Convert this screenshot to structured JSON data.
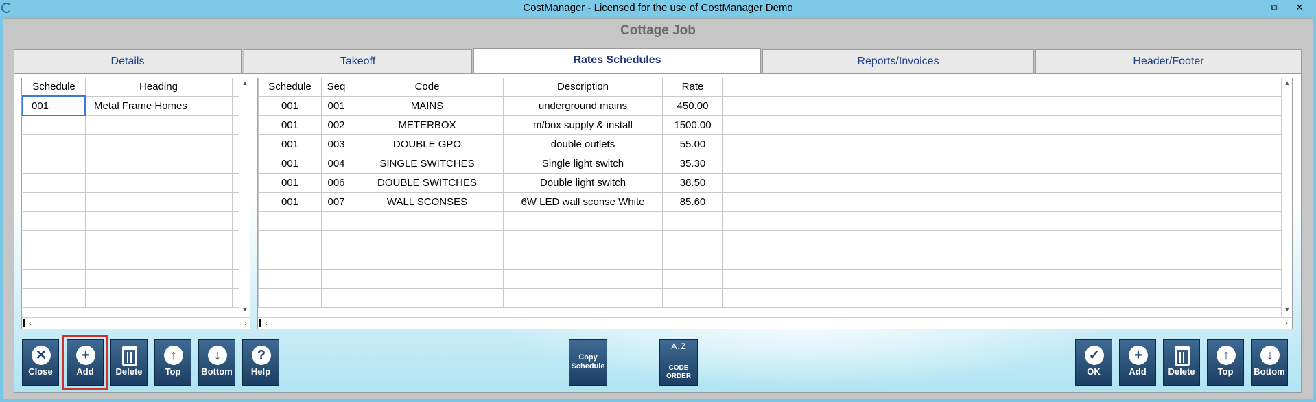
{
  "window": {
    "title": "CostManager - Licensed for the use of CostManager Demo",
    "minimize": "–",
    "restore": "⧉",
    "close": "✕"
  },
  "job_title": "Cottage Job",
  "tabs": [
    {
      "label": "Details"
    },
    {
      "label": "Takeoff"
    },
    {
      "label": "Rates Schedules"
    },
    {
      "label": "Reports/Invoices"
    },
    {
      "label": "Header/Footer"
    }
  ],
  "schedules_grid": {
    "headers": [
      "Schedule",
      "Heading"
    ],
    "rows": [
      {
        "schedule": "001",
        "heading": "Metal Frame Homes"
      }
    ]
  },
  "rates_grid": {
    "headers": [
      "Schedule",
      "Seq",
      "Code",
      "Description",
      "Rate"
    ],
    "rows": [
      {
        "schedule": "001",
        "seq": "001",
        "code": "MAINS",
        "description": "underground mains",
        "rate": "450.00"
      },
      {
        "schedule": "001",
        "seq": "002",
        "code": "METERBOX",
        "description": "m/box supply & install",
        "rate": "1500.00"
      },
      {
        "schedule": "001",
        "seq": "003",
        "code": "DOUBLE GPO",
        "description": "double outlets",
        "rate": "55.00"
      },
      {
        "schedule": "001",
        "seq": "004",
        "code": "SINGLE SWITCHES",
        "description": "Single light switch",
        "rate": "35.30"
      },
      {
        "schedule": "001",
        "seq": "006",
        "code": "DOUBLE SWITCHES",
        "description": "Double light switch",
        "rate": "38.50"
      },
      {
        "schedule": "001",
        "seq": "007",
        "code": "WALL SCONSES",
        "description": "6W LED wall sconse White",
        "rate": "85.60"
      }
    ]
  },
  "left_buttons": [
    {
      "label": "Close",
      "icon": "close-icon",
      "glyph": "✕"
    },
    {
      "label": "Add",
      "icon": "plus-icon",
      "glyph": "+"
    },
    {
      "label": "Delete",
      "icon": "trash-icon",
      "glyph": ""
    },
    {
      "label": "Top",
      "icon": "arrow-up-icon",
      "glyph": "↑"
    },
    {
      "label": "Bottom",
      "icon": "arrow-down-icon",
      "glyph": "↓"
    },
    {
      "label": "Help",
      "icon": "help-icon",
      "glyph": "?"
    }
  ],
  "center_buttons": {
    "copy_schedule": {
      "line1": "Copy",
      "line2": "Schedule"
    },
    "code_order": {
      "az": "A↓Z",
      "line1": "CODE",
      "line2": "ORDER"
    }
  },
  "right_buttons": [
    {
      "label": "OK",
      "icon": "check-icon",
      "glyph": "✓"
    },
    {
      "label": "Add",
      "icon": "plus-icon",
      "glyph": "+"
    },
    {
      "label": "Delete",
      "icon": "trash-icon",
      "glyph": ""
    },
    {
      "label": "Top",
      "icon": "arrow-up-icon",
      "glyph": "↑"
    },
    {
      "label": "Bottom",
      "icon": "arrow-down-icon",
      "glyph": "↓"
    }
  ],
  "colors": {
    "title_bar": "#7dc9e8",
    "button": "#1f4670",
    "selected_outline": "#d03030",
    "tab_text": "#1f3c8a"
  }
}
